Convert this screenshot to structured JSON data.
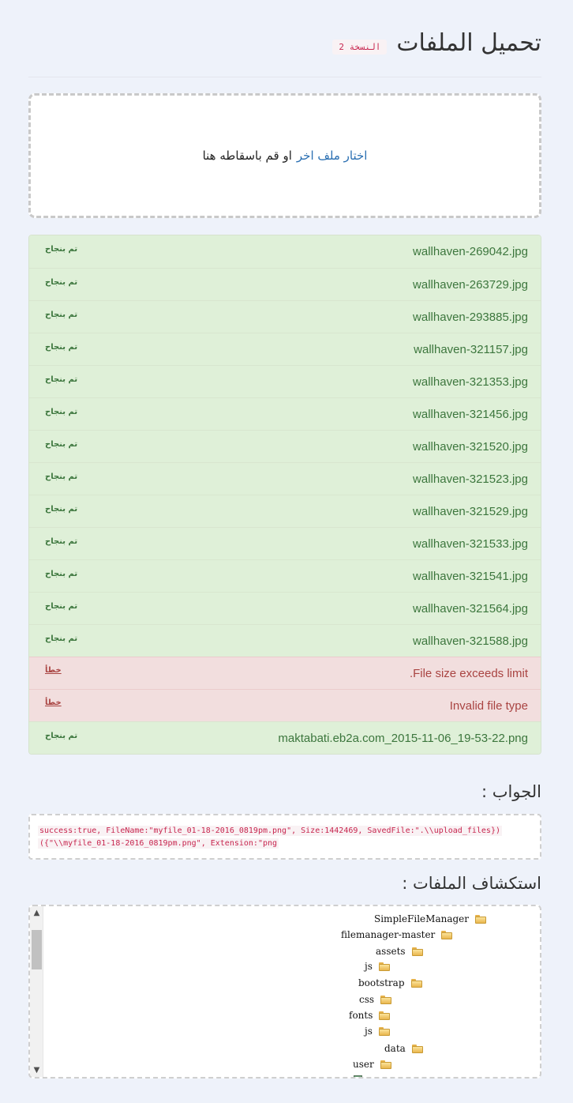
{
  "header": {
    "title": "تحميل الملفات",
    "version": "النسخة 2"
  },
  "dropzone": {
    "choose_link": "اختار ملف اخر",
    "rest_text": "او قم باسقاطه هنا"
  },
  "uploads": [
    {
      "name": "wallhaven-269042.jpg",
      "status": "تم بنجاح",
      "state": "success"
    },
    {
      "name": "wallhaven-263729.jpg",
      "status": "تم بنجاح",
      "state": "success"
    },
    {
      "name": "wallhaven-293885.jpg",
      "status": "تم بنجاح",
      "state": "success"
    },
    {
      "name": "wallhaven-321157.jpg",
      "status": "تم بنجاح",
      "state": "success"
    },
    {
      "name": "wallhaven-321353.jpg",
      "status": "تم بنجاح",
      "state": "success"
    },
    {
      "name": "wallhaven-321456.jpg",
      "status": "تم بنجاح",
      "state": "success"
    },
    {
      "name": "wallhaven-321520.jpg",
      "status": "تم بنجاح",
      "state": "success"
    },
    {
      "name": "wallhaven-321523.jpg",
      "status": "تم بنجاح",
      "state": "success"
    },
    {
      "name": "wallhaven-321529.jpg",
      "status": "تم بنجاح",
      "state": "success"
    },
    {
      "name": "wallhaven-321533.jpg",
      "status": "تم بنجاح",
      "state": "success"
    },
    {
      "name": "wallhaven-321541.jpg",
      "status": "تم بنجاح",
      "state": "success"
    },
    {
      "name": "wallhaven-321564.jpg",
      "status": "تم بنجاح",
      "state": "success"
    },
    {
      "name": "wallhaven-321588.jpg",
      "status": "تم بنجاح",
      "state": "success"
    },
    {
      "name": "File size exceeds limit.",
      "status": "خطأ",
      "state": "error"
    },
    {
      "name": "Invalid file type",
      "status": "خطأ",
      "state": "error"
    },
    {
      "name": "maktabati.eb2a.com_2015-11-06_19-53-22.png",
      "status": "تم بنجاح",
      "state": "success"
    }
  ],
  "response": {
    "title": "الجواب :",
    "line1": "success:true, FileName:\"myfile_01-18-2016_0819pm.png\", Size:1442469, SavedFile:\".\\\\upload_files})",
    "line2": "({\"\\\\myfile_01-18-2016_0819pm.png\", Extension:\"png"
  },
  "explorer": {
    "title": "استكشاف الملفات :",
    "items": [
      {
        "label": "SimpleFileManager",
        "icon": "folder-icon"
      },
      {
        "label": "filemanager-master",
        "icon": "folder-icon"
      },
      {
        "label": "assets",
        "icon": "folder-icon"
      },
      {
        "label": "js",
        "icon": "folder-icon"
      },
      {
        "label": "bootstrap",
        "icon": "folder-icon"
      },
      {
        "label": "css",
        "icon": "folder-icon"
      },
      {
        "label": "fonts",
        "icon": "folder-icon"
      },
      {
        "label": "js",
        "icon": "folder-icon"
      },
      {
        "label": "data",
        "icon": "folder-icon"
      },
      {
        "label": "user",
        "icon": "folder-icon"
      },
      {
        "label": "",
        "icon": "image-file-icon"
      }
    ]
  },
  "colors": {
    "success_bg": "#dff0d8",
    "success_text": "#3c763d",
    "error_bg": "#f2dede",
    "error_text": "#a94442",
    "link": "#2a6fb2",
    "code_text": "#c7254e"
  }
}
